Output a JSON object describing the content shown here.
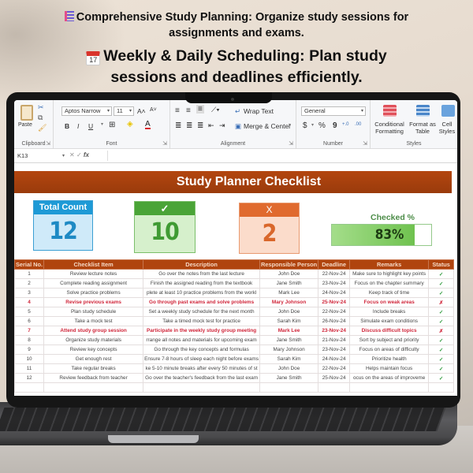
{
  "promo": {
    "line1_icon": "list-emoji-icon",
    "line1": "Comprehensive Study Planning: Organize study sessions for assignments and exams.",
    "line2_icon": "calendar-emoji-icon",
    "line2_icon_text": "17",
    "line2": "Weekly & Daily Scheduling: Plan study sessions and deadlines efficiently."
  },
  "ribbon": {
    "clipboard": {
      "paste_label": "Paste",
      "group_label": "Clipboard"
    },
    "font": {
      "font_name": "Aptos Narrow",
      "font_size": "11",
      "grow_label": "A˄",
      "shrink_label": "A˅",
      "bold": "B",
      "italic": "I",
      "underline": "U",
      "group_label": "Font"
    },
    "alignment": {
      "wrap_text": "Wrap Text",
      "merge_center": "Merge & Center",
      "group_label": "Alignment"
    },
    "number": {
      "format": "General",
      "currency": "$",
      "percent": "%",
      "comma": "9",
      "inc_decimal": "+.0",
      "dec_decimal": ".00",
      "group_label": "Number"
    },
    "styles": {
      "conditional_formatting": "Conditional Formatting",
      "format_as_table": "Format as Table",
      "cell_styles": "Cell Styles",
      "group_label": "Styles"
    }
  },
  "formula_bar": {
    "name_box": "K13",
    "cancel": "✕",
    "enter": "✓",
    "fx": "fx",
    "value": ""
  },
  "sheet": {
    "title": "Study Planner Checklist",
    "kpis": {
      "total": {
        "label": "Total Count",
        "value": "12"
      },
      "checked": {
        "label": "✓",
        "value": "10"
      },
      "unchecked": {
        "label": "X",
        "value": "2"
      }
    },
    "checked_percent": {
      "label": "Checked %",
      "value_text": "83%",
      "fraction": 0.83
    },
    "colors": {
      "banner": "#b0440e",
      "total": "#1e9ad6",
      "checked": "#4aa437",
      "unchecked": "#e06a2e",
      "flag_text": "#d0263a"
    },
    "table": {
      "columns": [
        "Serial No.",
        "Checklist Item",
        "Description",
        "Responsible Person",
        "Deadline",
        "Remarks",
        "Status"
      ],
      "rows": [
        {
          "serial": "1",
          "item": "Review lecture notes",
          "description": "Go over the notes from the last lecture",
          "person": "John Doe",
          "deadline": "22-Nov-24",
          "remarks": "Make sure to highlight key points",
          "status": "✓",
          "flag": false
        },
        {
          "serial": "2",
          "item": "Complete reading assignment",
          "description": "Finish the assigned reading from the textbook",
          "person": "Jane Smith",
          "deadline": "23-Nov-24",
          "remarks": "Focus on the chapter summary",
          "status": "✓",
          "flag": false
        },
        {
          "serial": "3",
          "item": "Solve practice problems",
          "description": "plete at least 10 practice problems from the workl",
          "person": "Mark Lee",
          "deadline": "24-Nov-24",
          "remarks": "Keep track of time",
          "status": "✓",
          "flag": false
        },
        {
          "serial": "4",
          "item": "Revise previous exams",
          "description": "Go through past exams and solve problems",
          "person": "Mary Johnson",
          "deadline": "25-Nov-24",
          "remarks": "Focus on weak areas",
          "status": "✗",
          "flag": true
        },
        {
          "serial": "5",
          "item": "Plan study schedule",
          "description": "Set a weekly study schedule for the next month",
          "person": "John Doe",
          "deadline": "22-Nov-24",
          "remarks": "Include breaks",
          "status": "✓",
          "flag": false
        },
        {
          "serial": "6",
          "item": "Take a mock test",
          "description": "Take a timed mock test for practice",
          "person": "Sarah Kim",
          "deadline": "26-Nov-24",
          "remarks": "Simulate exam conditions",
          "status": "✓",
          "flag": false
        },
        {
          "serial": "7",
          "item": "Attend study group session",
          "description": "Participate in the weekly study group meeting",
          "person": "Mark Lee",
          "deadline": "23-Nov-24",
          "remarks": "Discuss difficult topics",
          "status": "✗",
          "flag": true
        },
        {
          "serial": "8",
          "item": "Organize study materials",
          "description": "rrange all notes and materials for upcoming exam",
          "person": "Jane Smith",
          "deadline": "21-Nov-24",
          "remarks": "Sort by subject and priority",
          "status": "✓",
          "flag": false
        },
        {
          "serial": "9",
          "item": "Review key concepts",
          "description": "Go through the key concepts and formulas",
          "person": "Mary Johnson",
          "deadline": "23-Nov-24",
          "remarks": "Focus on areas of difficulty",
          "status": "✓",
          "flag": false
        },
        {
          "serial": "10",
          "item": "Get enough rest",
          "description": "Ensure 7-8 hours of sleep each night before exams",
          "person": "Sarah Kim",
          "deadline": "24-Nov-24",
          "remarks": "Prioritize health",
          "status": "✓",
          "flag": false
        },
        {
          "serial": "11",
          "item": "Take regular breaks",
          "description": "ke 5-10 minute breaks after every 50 minutes of st",
          "person": "John Doe",
          "deadline": "22-Nov-24",
          "remarks": "Helps maintain focus",
          "status": "✓",
          "flag": false
        },
        {
          "serial": "12",
          "item": "Review feedback from teacher",
          "description": "Go over the teacher's feedback from the last exam",
          "person": "Jane Smith",
          "deadline": "25-Nov-24",
          "remarks": "ocus on the areas of improveme",
          "status": "✓",
          "flag": false
        }
      ]
    }
  }
}
